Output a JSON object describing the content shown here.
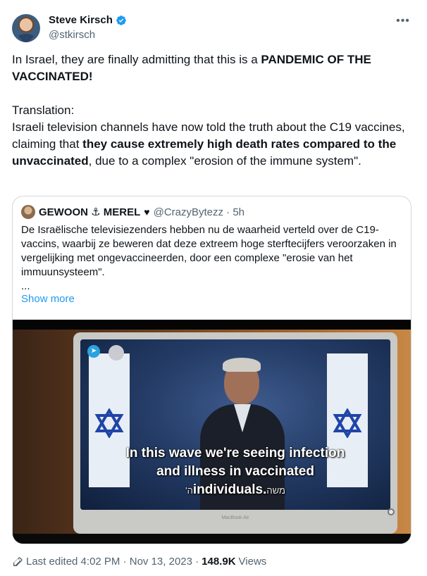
{
  "author": {
    "name": "Steve Kirsch",
    "handle": "@stkirsch",
    "verified_color": "#1d9bf0"
  },
  "more_icon": "more-horizontal-icon",
  "tweet": {
    "line1_prefix": "In Israel, they are finally admitting that this is a ",
    "line1_bold": "PANDEMIC OF THE VACCINATED!",
    "translation_label": "Translation:",
    "body_prefix": "Israeli television channels have now told the truth about the C19 vaccines, claiming that ",
    "body_bold": "they cause extremely high death rates compared to the unvaccinated",
    "body_suffix": ", due to a complex \"erosion of the immune system\"."
  },
  "quote": {
    "name": "GEWOON ⚓ MEREL",
    "heart_icon": "heart-icon",
    "handle_time": "@CrazyBytezz · 5h",
    "text": "De Israëlische televisiezenders hebben nu de waarheid verteld over de C19-vaccins, waarbij ze beweren dat deze extreem hoge sterftecijfers veroorzaken in vergelijking met ongevaccineerden, door een complexe \"erosie van het immuunsysteem\".",
    "ellipsis": "...",
    "show_more": "Show more"
  },
  "video": {
    "subtitle_line1": "In this wave we're seeing infection",
    "subtitle_line2": "and illness in vaccinated",
    "subtitle_line3": "individuals.",
    "hebrew_caption": "משה",
    "hebrew_prefix": "'ה",
    "laptop_brand": "MacBook Air"
  },
  "footer": {
    "edit_label": "Last edited 4:02 PM · Nov 13, 2023 · ",
    "views_count": "148.9K",
    "views_label": " Views"
  },
  "colors": {
    "link": "#1d9bf0",
    "secondary_text": "#536471",
    "border": "#cfd9de"
  }
}
